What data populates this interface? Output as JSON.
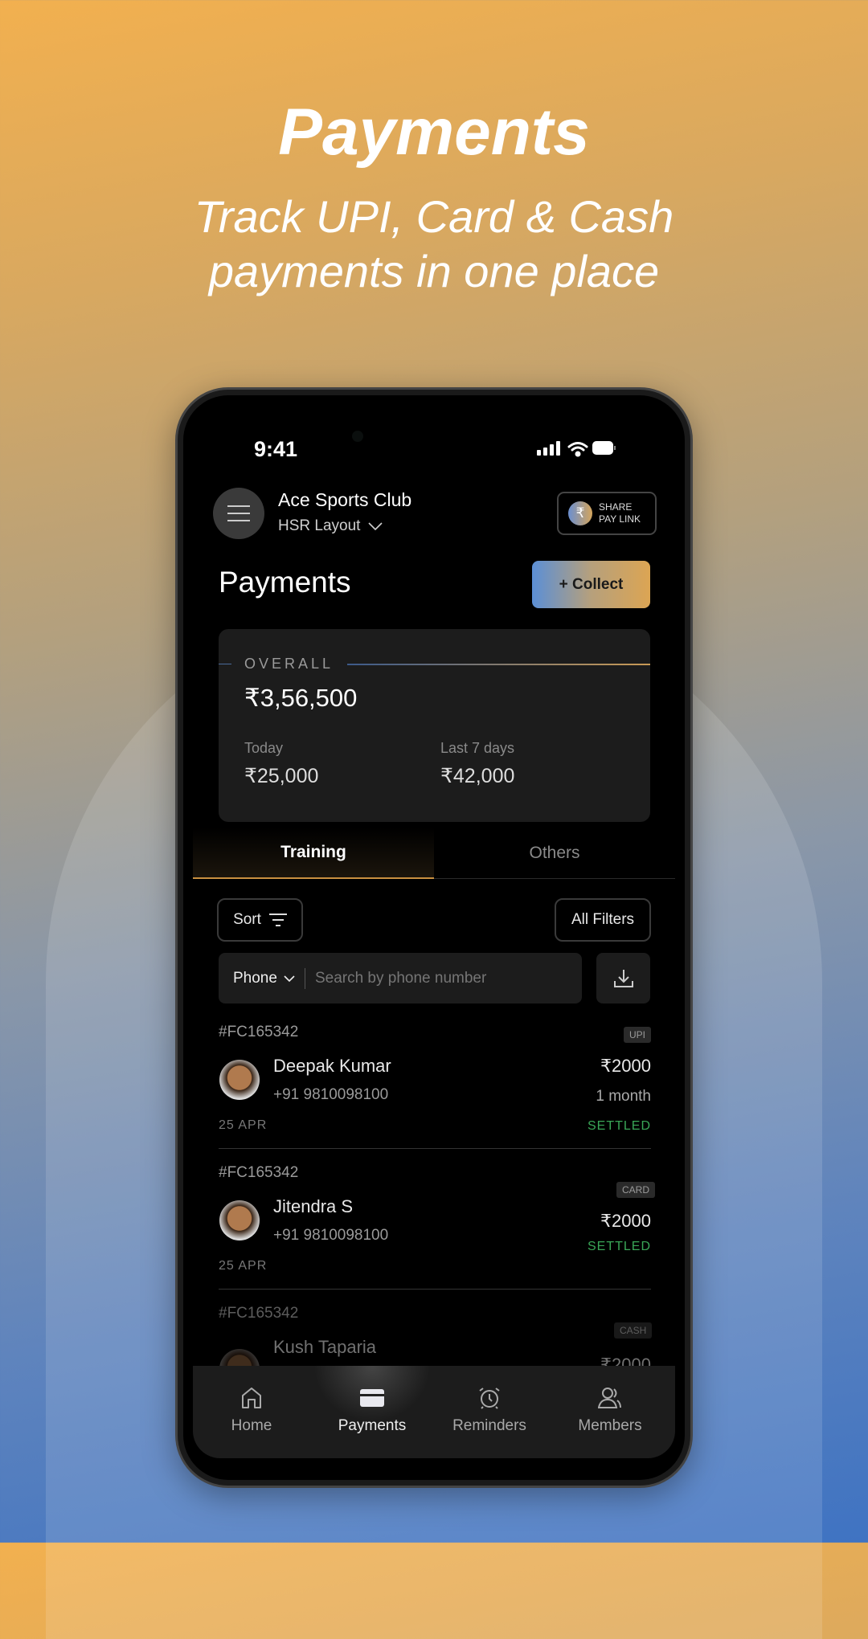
{
  "hero": {
    "title": "Payments",
    "subtitle_line1": "Track UPI, Card & Cash",
    "subtitle_line2": "payments in one place"
  },
  "status_bar": {
    "time": "9:41"
  },
  "header": {
    "club_name": "Ace Sports Club",
    "location": "HSR Layout",
    "share_line1": "SHARE",
    "share_line2": "PAY LINK",
    "rupee": "₹"
  },
  "page": {
    "title": "Payments",
    "collect_label": "+ Collect"
  },
  "overall": {
    "label": "OVERALL",
    "amount": "₹3,56,500",
    "today_label": "Today",
    "today_value": "₹25,000",
    "week_label": "Last 7 days",
    "week_value": "₹42,000"
  },
  "tabs": [
    {
      "label": "Training",
      "active": true
    },
    {
      "label": "Others",
      "active": false
    }
  ],
  "filters": {
    "sort_label": "Sort",
    "all_filters_label": "All Filters",
    "search_type": "Phone",
    "search_placeholder": "Search by phone number"
  },
  "payments": [
    {
      "id": "#FC165342",
      "method": "UPI",
      "name": "Deepak Kumar",
      "phone": "+91 9810098100",
      "amount": "₹2000",
      "duration": "1 month",
      "status": "SETTLED",
      "date": "25 APR"
    },
    {
      "id": "#FC165342",
      "method": "CARD",
      "name": "Jitendra S",
      "phone": "+91 9810098100",
      "amount": "₹2000",
      "status": "SETTLED",
      "date": "25 APR"
    },
    {
      "id": "#FC165342",
      "method": "CASH",
      "name": "Kush Taparia",
      "amount": "₹2000"
    }
  ],
  "nav": [
    {
      "label": "Home",
      "icon": "home-icon"
    },
    {
      "label": "Payments",
      "icon": "card-icon",
      "active": true
    },
    {
      "label": "Reminders",
      "icon": "alarm-clock-icon"
    },
    {
      "label": "Members",
      "icon": "users-icon"
    }
  ],
  "colors": {
    "accent_orange": "#d9a050",
    "accent_blue": "#5b8fd6",
    "settled": "#3aa657"
  }
}
